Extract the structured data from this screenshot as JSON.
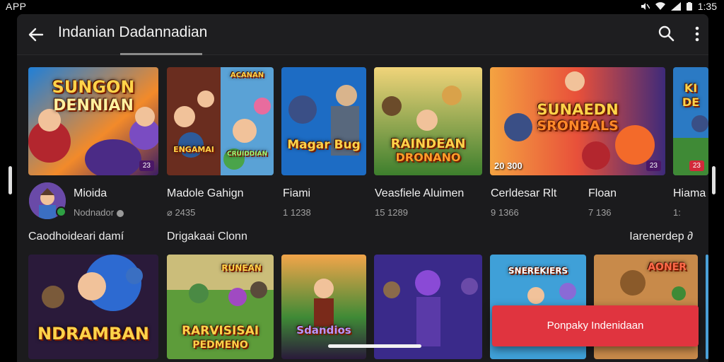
{
  "statusbar": {
    "app_label": "APP",
    "time": "1:35",
    "icons": [
      "mute-icon",
      "wifi-icon",
      "signal-icon",
      "battery-icon"
    ]
  },
  "appbar": {
    "title": "Indanian Dadannadian",
    "back_icon": "arrow-left-icon",
    "search_icon": "search-icon",
    "more_icon": "more-vert-icon"
  },
  "row1": {
    "cards": [
      {
        "art_title": "SUNGON",
        "art_title2": "DENNIAN",
        "badge": "23"
      },
      {
        "art_title": "ACANAN",
        "art_title2": "ENGAMAI",
        "art_title3": "CRUIDDIAN"
      },
      {
        "art_title": "Magar Bug"
      },
      {
        "art_title": "RAINDEAN",
        "art_title2": "DRONANO"
      },
      {
        "art_title": "SUNAEDN",
        "art_title2": "SRONBALS",
        "badge_left": "20 300",
        "badge": "23"
      },
      {
        "art_title": "KI",
        "art_title2": "DE",
        "badge": "23"
      }
    ],
    "items": [
      {
        "name": "Mioida",
        "sub": "Nodnador"
      },
      {
        "name": "Madole Gahign",
        "sub": "2435"
      },
      {
        "name": "Fiami",
        "sub": "1 1238"
      },
      {
        "name": "Veasfiele Aluimen",
        "sub": "15 1289"
      },
      {
        "name": "Cerldesar Rlt",
        "sub": "9 1366"
      },
      {
        "name": "Floan",
        "sub": "7 136"
      },
      {
        "name": "Hiama",
        "sub": "1:"
      }
    ]
  },
  "row2": {
    "label_left": "Caodhoideari damí",
    "label_mid": "Drigakaai Clonn",
    "link": "Iarenerdep ∂",
    "cards": [
      {
        "art_title": "NDRAMBAN"
      },
      {
        "art_title": "RARVISISAI",
        "art_title2": "PEDMENO",
        "art_title3": "RUNEAN"
      },
      {
        "art_title": "Sdandios"
      },
      {
        "art_title": ""
      },
      {
        "art_title": "SNEREKIERS"
      },
      {
        "art_title": "AONER"
      }
    ]
  },
  "toast": {
    "label": "Ponpaky Indenidaan"
  },
  "colors": {
    "background": "#1b1b1d",
    "accent": "#e0343f",
    "appbar": "#1e1e20"
  }
}
